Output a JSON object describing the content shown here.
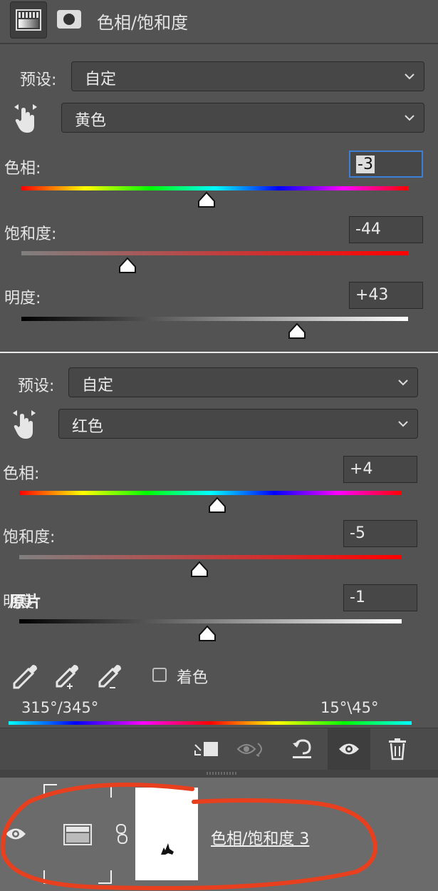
{
  "header": {
    "title": "色相/饱和度"
  },
  "panel1": {
    "preset_label": "预设:",
    "preset_value": "自定",
    "channel_value": "黄色",
    "hue_label": "色相:",
    "hue_value": "-3",
    "saturation_label": "饱和度:",
    "saturation_value": "-44",
    "lightness_label": "明度:",
    "lightness_value": "+43"
  },
  "panel2": {
    "preset_label": "预设:",
    "preset_value": "自定",
    "channel_value": "红色",
    "hue_label": "色相:",
    "hue_value": "+4",
    "saturation_label": "饱和度:",
    "saturation_value": "-5",
    "lightness_label": "明度:",
    "lightness_overlay": "原片",
    "lightness_value": "-1",
    "colorize_label": "着色",
    "colorize_checked": false,
    "range_left": "315°/345°",
    "range_right": "15°\\45°"
  },
  "layers": {
    "layer_name": "色相/饱和度 3"
  },
  "colors": {
    "accent": "#3d7fd6",
    "annotation": "#e8401f"
  },
  "icons": [
    "adjustment-icon",
    "mask-icon",
    "hand-target-icon",
    "chevron-down-icon",
    "eyedropper-icon",
    "eyedropper-plus-icon",
    "eyedropper-minus-icon",
    "clip-icon",
    "view-previous-icon",
    "reset-icon",
    "eye-icon",
    "trash-icon",
    "link-icon"
  ]
}
